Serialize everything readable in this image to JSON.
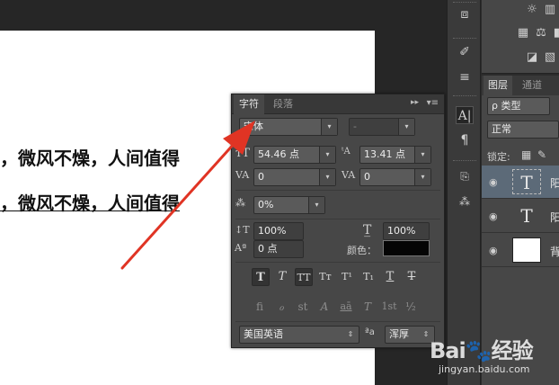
{
  "document": {
    "line1": "，微风不燥，人间值得",
    "line2": "，微风不燥，人间值得"
  },
  "character_panel": {
    "tabs": [
      "字符",
      "段落"
    ],
    "font_family": "宋体",
    "font_style": "-",
    "font_size": "54.46 点",
    "leading": "13.41 点",
    "kerning": "0",
    "tracking": "0",
    "tsume": "0%",
    "vertical_scale": "100%",
    "horizontal_scale": "100%",
    "baseline_shift": "0 点",
    "color_label": "颜色：",
    "color_value": "#050505",
    "type_buttons": [
      "T",
      "T",
      "TT",
      "Tт",
      "T¹",
      "T₁",
      "T",
      "T"
    ],
    "opentype_buttons": [
      "fi",
      "ℴ",
      "st",
      "A",
      "aā",
      "T",
      "1st",
      "½"
    ],
    "language": "美国英语",
    "aa_icon": "ªa",
    "antialias": "浑厚"
  },
  "toolbar_icons": [
    "cube-icon",
    "brush-adjust-icon",
    "sliders-icon",
    "type-panel-icon",
    "paragraph-icon",
    "char-style-icon",
    "para-style-icon"
  ],
  "layers_panel": {
    "tabs": [
      "图层",
      "通道"
    ],
    "filter_label": "ρ 类型",
    "blend_mode": "正常",
    "lock_label": "锁定:",
    "layers": [
      {
        "name": "阳",
        "type": "text",
        "selected": true
      },
      {
        "name": "阳",
        "type": "text",
        "selected": false
      },
      {
        "name": "背",
        "type": "image",
        "selected": false
      }
    ]
  },
  "watermark": {
    "brand": "Bai",
    "brand_suffix": "经验",
    "url": "jingyan.baidu.com"
  },
  "colors": {
    "panel_bg": "#474747",
    "arrow": "#e03424",
    "canvas": "#ffffff"
  }
}
